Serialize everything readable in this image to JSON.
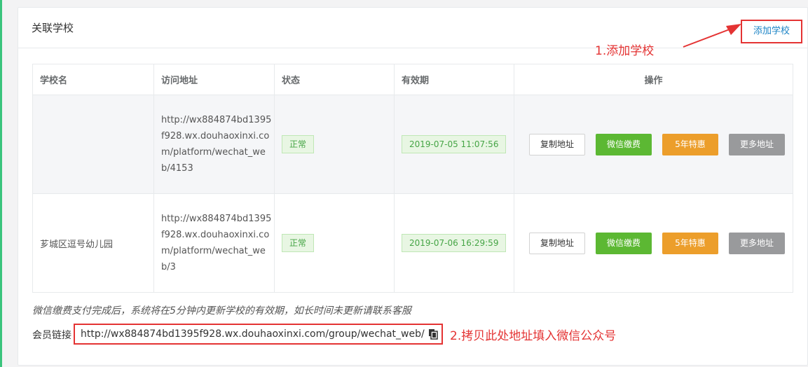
{
  "panel": {
    "title": "关联学校",
    "add_button": "添加学校"
  },
  "annotations": {
    "step1": "1.添加学校",
    "step2": "2.拷贝此处地址填入微信公众号"
  },
  "table": {
    "headers": [
      "学校名",
      "访问地址",
      "状态",
      "有效期",
      "操作"
    ],
    "rows": [
      {
        "name": "",
        "url": "http://wx884874bd1395f928.wx.douhaoxinxi.com/platform/wechat_web/4153",
        "status": "正常",
        "expiry": "2019-07-05 11:07:56"
      },
      {
        "name": "芗城区逗号幼儿园",
        "url": "http://wx884874bd1395f928.wx.douhaoxinxi.com/platform/wechat_web/3",
        "status": "正常",
        "expiry": "2019-07-06 16:29:59"
      }
    ],
    "actions": {
      "copy": "复制地址",
      "wechat_pay": "微信缴费",
      "five_year": "5年特惠",
      "more": "更多地址"
    }
  },
  "note": "微信缴费支付完成后，系统将在5分钟内更新学校的有效期，如长时间未更新请联系客服",
  "member": {
    "label": "会员链接",
    "url": "http://wx884874bd1395f928.wx.douhaoxinxi.com/group/wechat_web/"
  },
  "colors": {
    "annotation": "#e43333",
    "link": "#1c84c6",
    "success": "#5cb833",
    "warning": "#ec9e2b",
    "muted": "#999a9c"
  }
}
